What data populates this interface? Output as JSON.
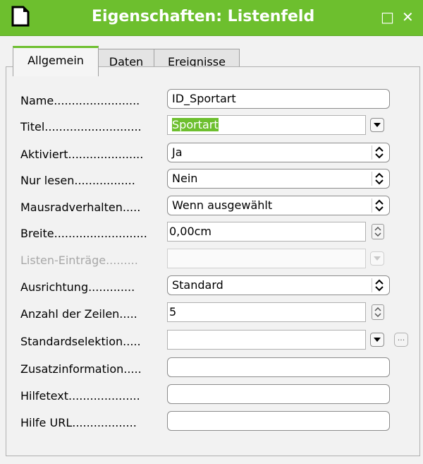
{
  "window": {
    "title": "Eigenschaften: Listenfeld",
    "maximize_glyph": "□",
    "close_glyph": "✕"
  },
  "tabs": [
    {
      "label": "Allgemein",
      "active": true
    },
    {
      "label": "Daten"
    },
    {
      "label": "Ereignisse"
    }
  ],
  "fields": {
    "name": {
      "label": "Name........................",
      "value": "ID_Sportart"
    },
    "titel": {
      "label": "Titel...........................",
      "value": "Sportart"
    },
    "aktiviert": {
      "label": "Aktiviert.....................",
      "value": "Ja"
    },
    "nur_lesen": {
      "label": "Nur lesen.................",
      "value": "Nein"
    },
    "mausrad": {
      "label": "Mausradverhalten.....",
      "value": "Wenn ausgewählt"
    },
    "breite": {
      "label": "Breite..........................",
      "value": "0,00cm"
    },
    "listen": {
      "label": "Listen-Einträge.........",
      "value": ""
    },
    "ausrichtung": {
      "label": "Ausrichtung.............",
      "value": "Standard"
    },
    "zeilen": {
      "label": "Anzahl der Zeilen.....",
      "value": "5"
    },
    "standardsel": {
      "label": "Standardselektion.....",
      "value": ""
    },
    "zusatz": {
      "label": "Zusatzinformation.....",
      "value": ""
    },
    "hilfetext": {
      "label": "Hilfetext....................",
      "value": ""
    },
    "hilfeurl": {
      "label": "Hilfe URL..................",
      "value": ""
    }
  },
  "dots_button_label": "..."
}
